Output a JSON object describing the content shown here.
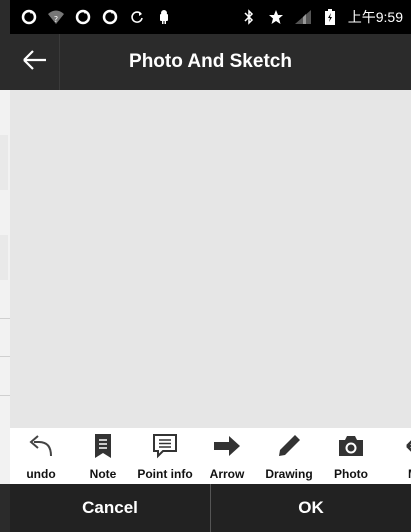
{
  "status_bar": {
    "time": "上午9:59"
  },
  "header": {
    "title": "Photo And Sketch"
  },
  "toolbar": {
    "items": [
      {
        "label": "undo"
      },
      {
        "label": "Note"
      },
      {
        "label": "Point info"
      },
      {
        "label": "Arrow"
      },
      {
        "label": "Drawing"
      },
      {
        "label": "Photo"
      },
      {
        "label": "M"
      }
    ]
  },
  "bottom": {
    "cancel_label": "Cancel",
    "ok_label": "OK"
  }
}
